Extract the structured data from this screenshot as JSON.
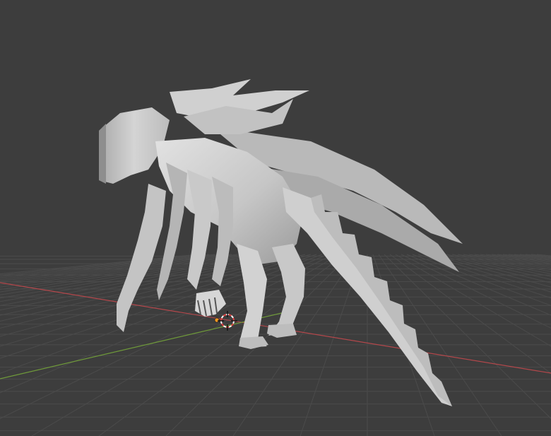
{
  "app": {
    "name": "",
    "mode": "viewport-3d"
  },
  "scene": {
    "object_icon": "creature-mesh",
    "cursor_icon": "3d-cursor-icon",
    "origin_icon": "object-origin-dot"
  },
  "colors": {
    "background": "#3d3d3d",
    "grid": "#4b4b4b",
    "x_axis": "#b3474b",
    "y_axis": "#6f9a3a",
    "mesh_light": "#d8d8d8",
    "mesh_mid": "#bdbdbd",
    "mesh_dark": "#8e8e8e",
    "origin": "#ff9a1f",
    "cursor_red": "#e0403f"
  }
}
